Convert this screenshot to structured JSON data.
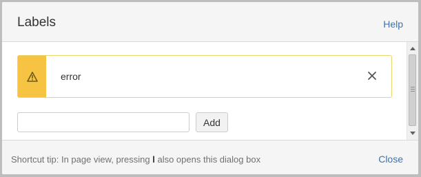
{
  "dialog": {
    "title": "Labels",
    "help_label": "Help"
  },
  "labels": [
    {
      "text": "error",
      "status": "warning"
    }
  ],
  "label_input": {
    "value": "",
    "placeholder": ""
  },
  "add_button": {
    "label": "Add"
  },
  "footer": {
    "tip_before": "Shortcut tip: In page view, pressing ",
    "tip_key": "l",
    "tip_after": " also opens this dialog box",
    "close_label": "Close"
  },
  "icons": {
    "warning": "warning-icon",
    "remove": "close-icon"
  },
  "colors": {
    "warning_strip": "#f6c342",
    "label_border": "#e8d56b",
    "link": "#3b73af"
  }
}
